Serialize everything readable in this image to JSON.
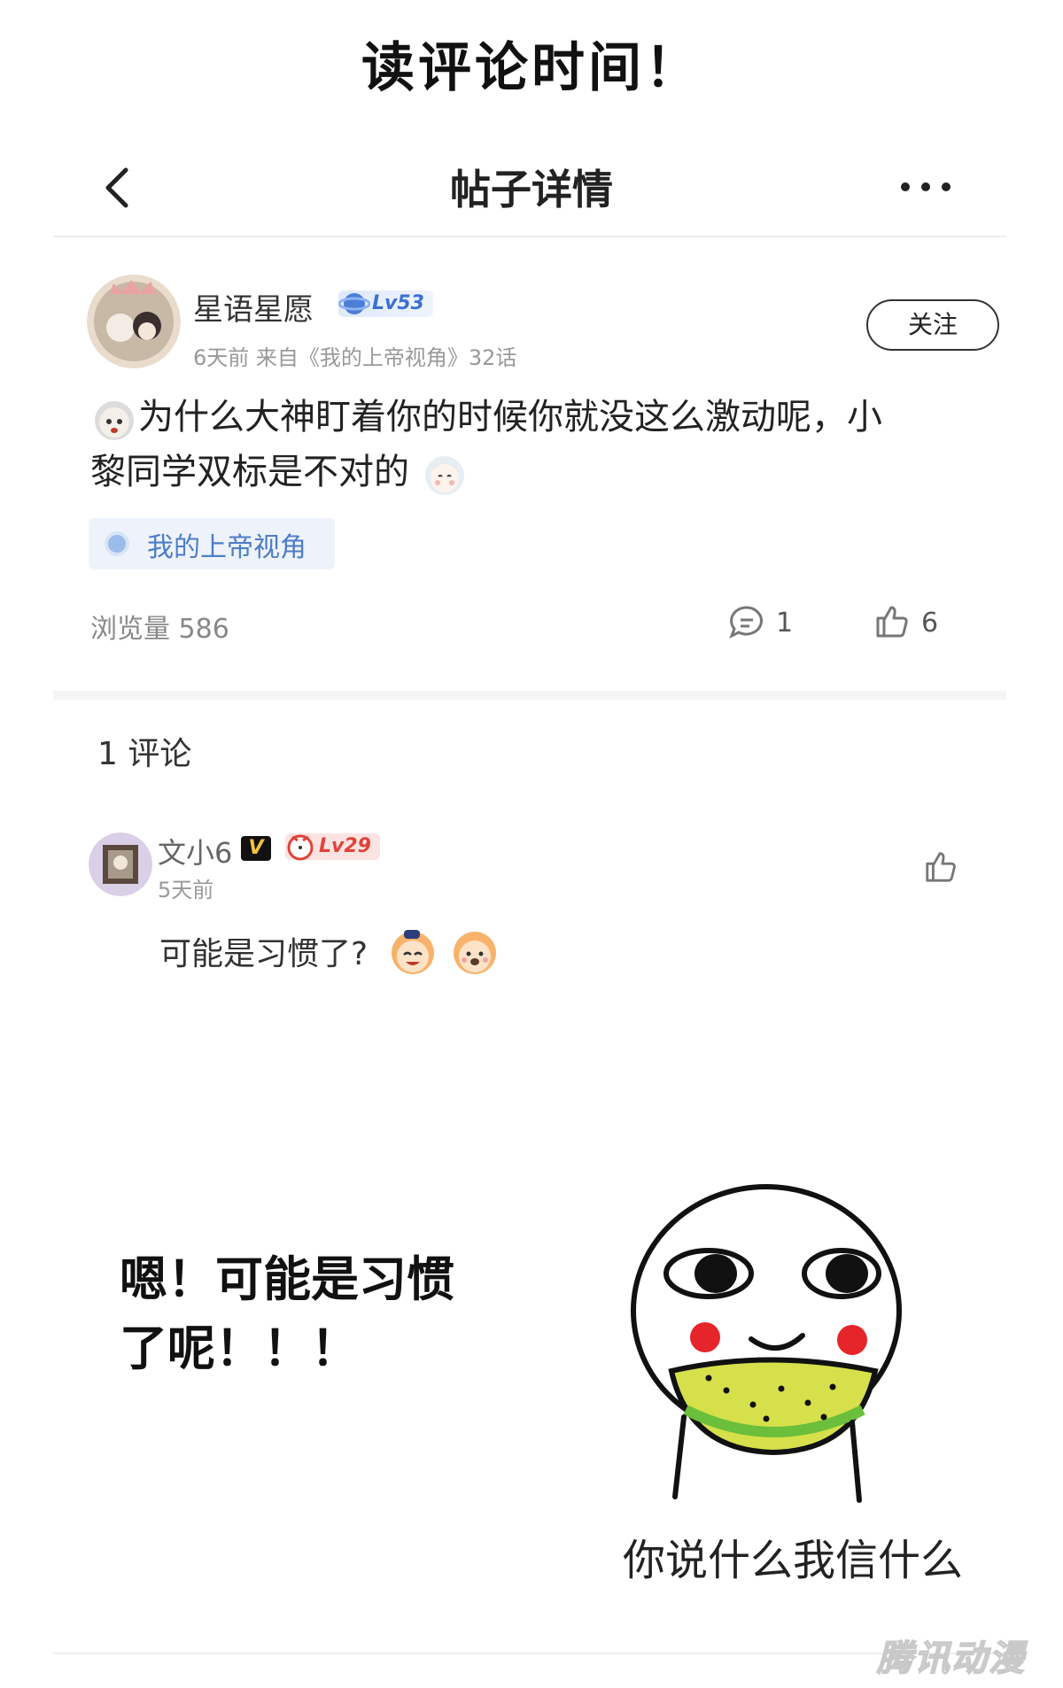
{
  "banner": {
    "title": "读评论时间！"
  },
  "nav": {
    "title": "帖子详情"
  },
  "post": {
    "author": "星语星愿",
    "level": "Lv53",
    "meta": "6天前 来自《我的上帝视角》32话",
    "follow_label": "关注",
    "text_line1": "为什么大神盯着你的时候你就没这么激动呢，小",
    "text_line2": "黎同学双标是不对的",
    "tag": "我的上帝视角",
    "views_label": "浏览量 586",
    "comments": "1",
    "likes": "6"
  },
  "comments_section": {
    "count_label": "1 评论",
    "comment": {
      "author": "文小6",
      "vip_badge": "V",
      "level": "Lv29",
      "time": "5天前",
      "text": "可能是习惯了?"
    }
  },
  "meme": {
    "left_line1": "嗯！可能是习惯",
    "left_line2": "了呢！！！",
    "right_caption": "你说什么我信什么"
  },
  "watermark": "腾讯动漫",
  "colors": {
    "accent_blue": "#4d7dc7",
    "tag_bg": "#eef3fb",
    "level_red": "#e0433a"
  }
}
